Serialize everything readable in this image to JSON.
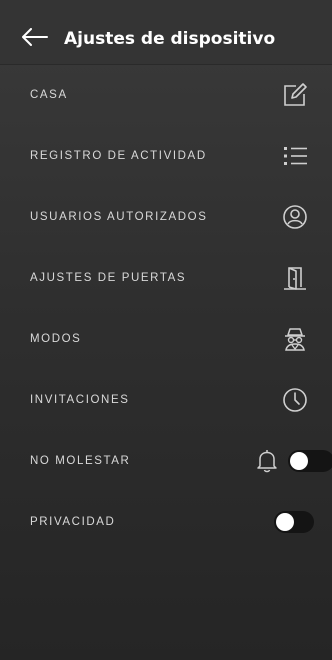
{
  "header": {
    "title": "Ajustes de dispositivo"
  },
  "menu": [
    {
      "label": "CASA",
      "icon": "edit-icon"
    },
    {
      "label": "REGISTRO DE ACTIVIDAD",
      "icon": "list-icon"
    },
    {
      "label": "USUARIOS AUTORIZADOS",
      "icon": "user-circle-icon"
    },
    {
      "label": "AJUSTES DE PUERTAS",
      "icon": "door-icon"
    },
    {
      "label": "MODOS",
      "icon": "incognito-icon"
    },
    {
      "label": "INVITACIONES",
      "icon": "clock-icon"
    },
    {
      "label": "NO MOLESTAR",
      "icon": "bell-icon",
      "toggle": false
    },
    {
      "label": "PRIVACIDAD",
      "toggle": false
    }
  ],
  "colors": {
    "background": "#2f2f2f",
    "text": "#d9d9d9",
    "title": "#ffffff",
    "toggle_track": "#141414",
    "toggle_knob": "#ffffff"
  }
}
